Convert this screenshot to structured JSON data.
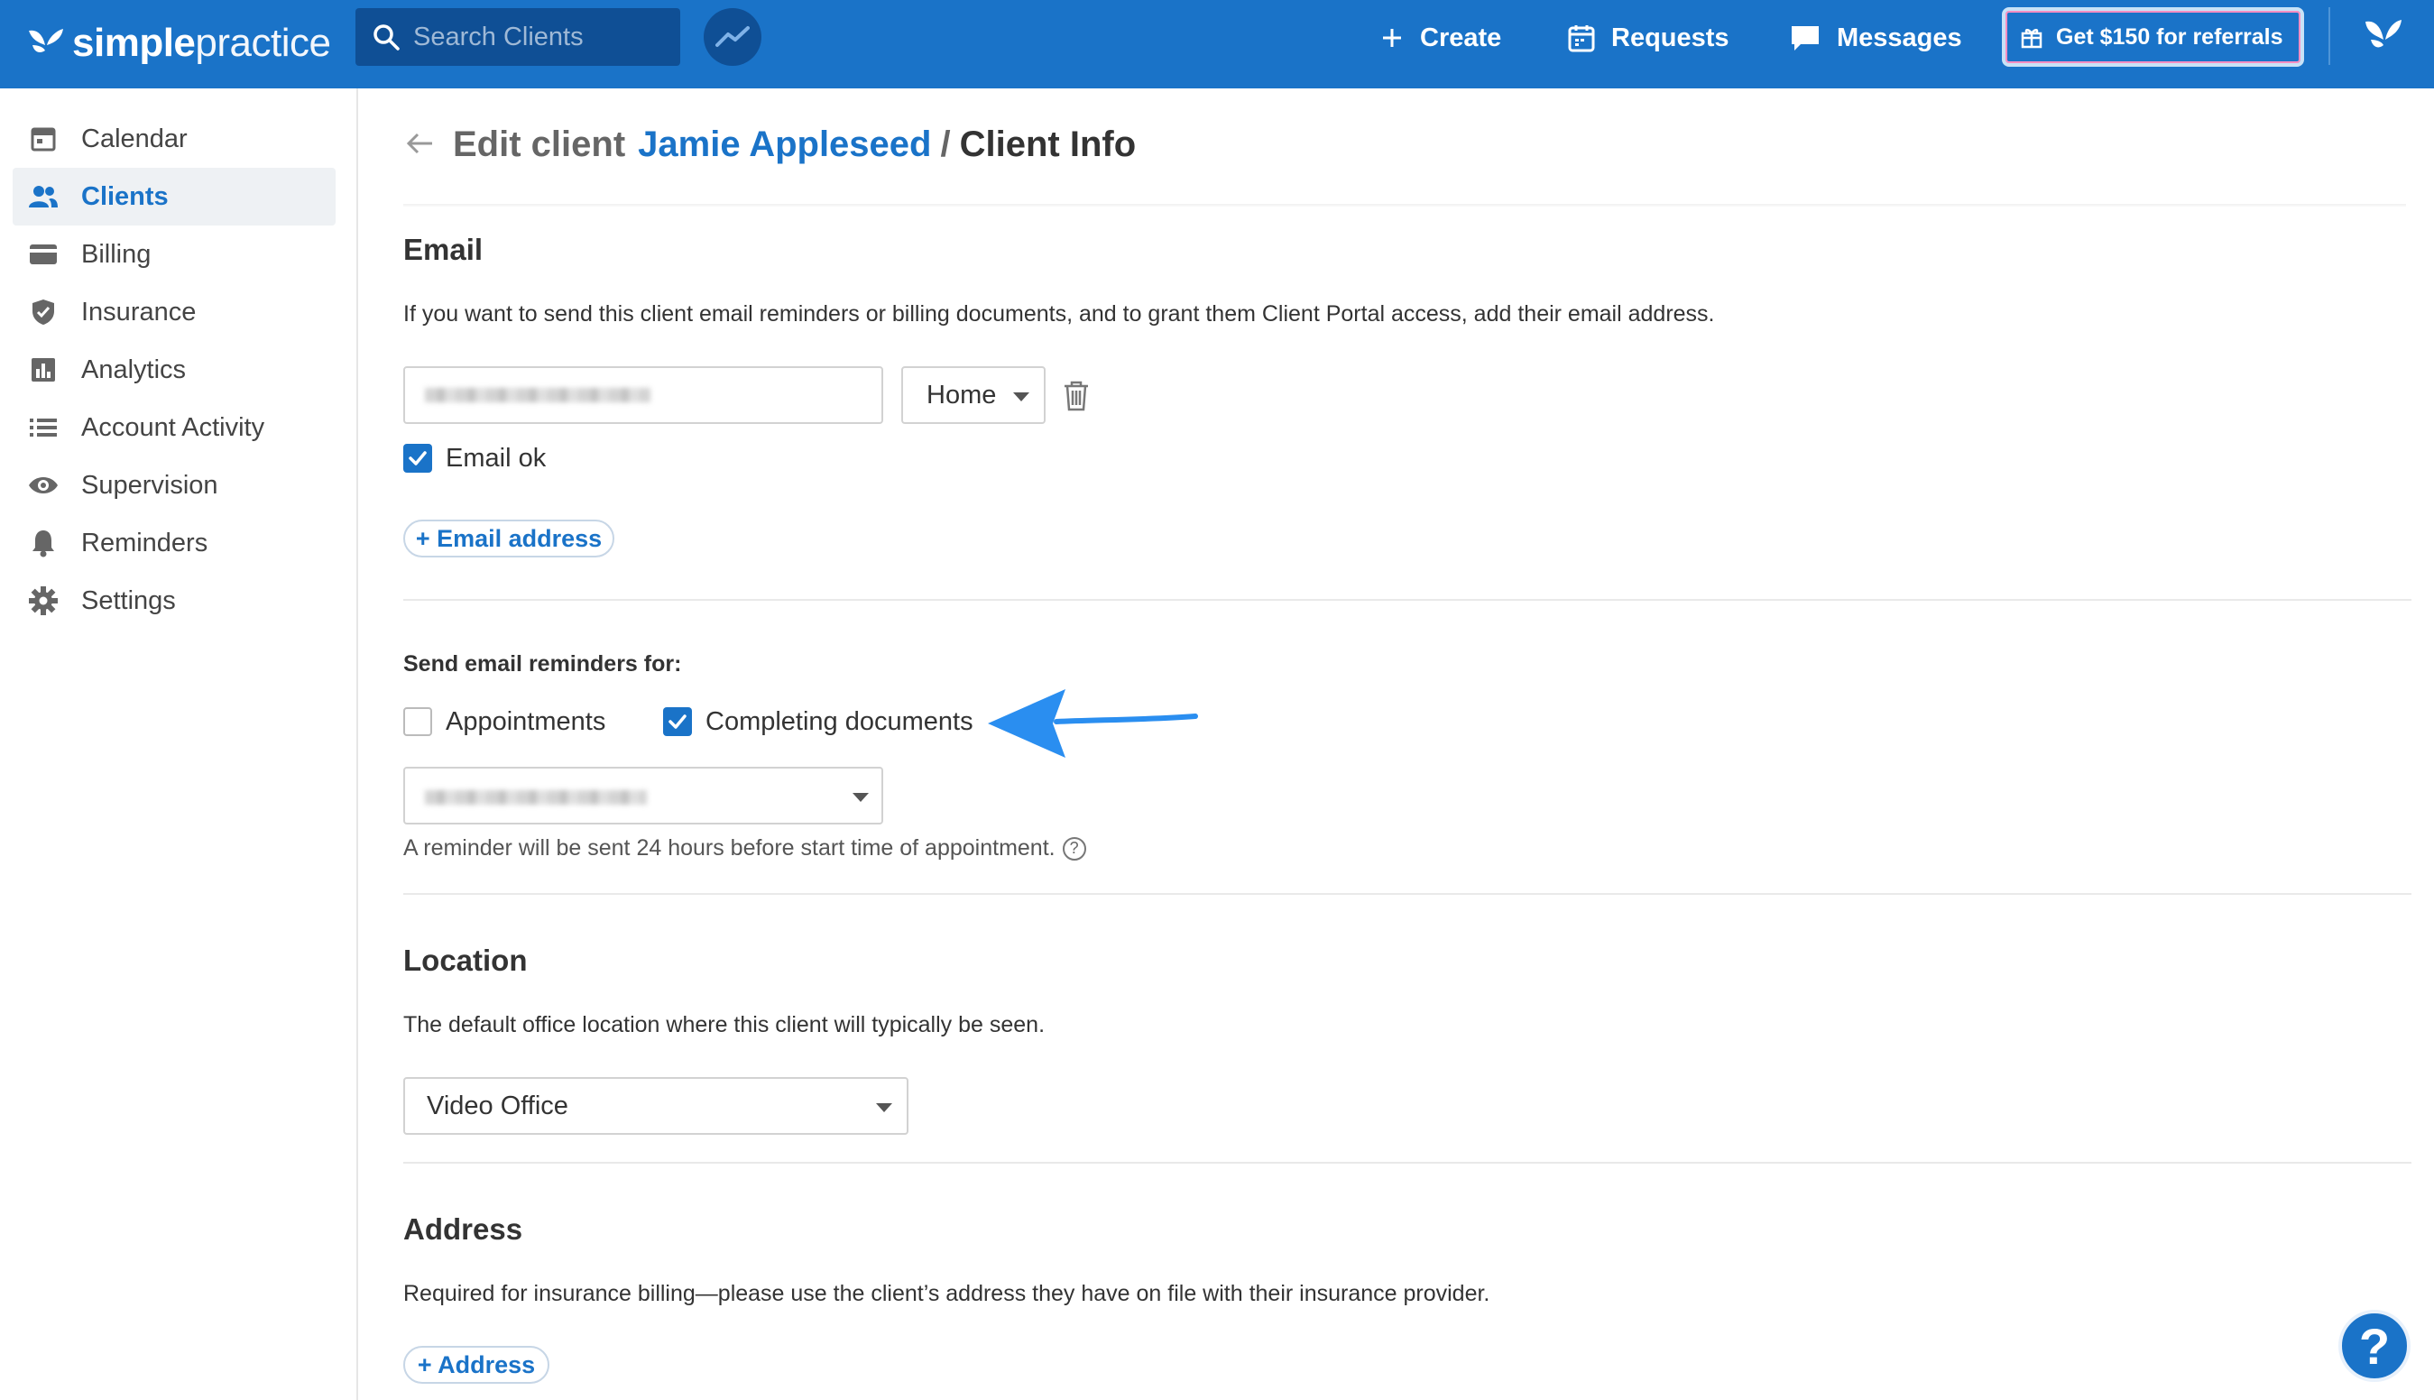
{
  "brand": {
    "name_part1": "simple",
    "name_part2": "practice",
    "primary_color": "#1a73c8"
  },
  "topbar": {
    "search_placeholder": "Search Clients",
    "create_label": "Create",
    "requests_label": "Requests",
    "messages_label": "Messages",
    "referral_label": "Get $150 for referrals"
  },
  "sidebar": {
    "items": [
      {
        "label": "Calendar",
        "icon": "calendar-icon",
        "active": false
      },
      {
        "label": "Clients",
        "icon": "clients-icon",
        "active": true
      },
      {
        "label": "Billing",
        "icon": "billing-icon",
        "active": false
      },
      {
        "label": "Insurance",
        "icon": "shield-icon",
        "active": false
      },
      {
        "label": "Analytics",
        "icon": "analytics-icon",
        "active": false
      },
      {
        "label": "Account Activity",
        "icon": "list-icon",
        "active": false
      },
      {
        "label": "Supervision",
        "icon": "eye-icon",
        "active": false
      },
      {
        "label": "Reminders",
        "icon": "bell-icon",
        "active": false
      },
      {
        "label": "Settings",
        "icon": "gear-icon",
        "active": false
      }
    ]
  },
  "page": {
    "title_prefix": "Edit client",
    "client_name": "Jamie Appleseed",
    "separator": "/",
    "title_suffix": "Client Info"
  },
  "email": {
    "heading": "Email",
    "description": "If you want to send this client email reminders or billing documents, and to grant them Client Portal access, add their email address.",
    "type_value": "Home",
    "email_ok_label": "Email ok",
    "email_ok_checked": true,
    "add_label": "+ Email address"
  },
  "reminders": {
    "label": "Send email reminders for:",
    "appointments_label": "Appointments",
    "appointments_checked": false,
    "documents_label": "Completing documents",
    "documents_checked": true,
    "hint": "A reminder will be sent 24 hours before start time of appointment.",
    "hint_icon": "?"
  },
  "location": {
    "heading": "Location",
    "description": "The default office location where this client will typically be seen.",
    "value": "Video Office"
  },
  "address": {
    "heading": "Address",
    "description": "Required for insurance billing—please use the client’s address they have on file with their insurance provider.",
    "add_label": "+ Address"
  },
  "help": {
    "label": "?"
  }
}
